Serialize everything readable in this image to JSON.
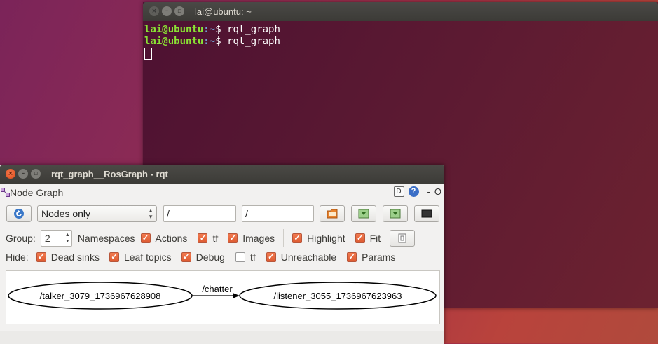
{
  "terminal": {
    "title": "lai@ubuntu: ~",
    "lines": [
      {
        "user": "lai@ubuntu",
        "path": ":~",
        "cmd": "$ rqt_graph"
      },
      {
        "user": "lai@ubuntu",
        "path": ":~",
        "cmd": "$ rqt_graph"
      }
    ]
  },
  "rqt": {
    "title": "rqt_graph__RosGraph - rqt",
    "plugin_title": "Node Graph",
    "plugin_btn_d": "D",
    "plugin_btn_help": "?",
    "plugin_btn_min": "-",
    "plugin_btn_close": "O",
    "toolbar": {
      "graph_mode": "Nodes only",
      "ns_filter": "/",
      "topic_filter": "/"
    },
    "group_row": {
      "group_label": "Group:",
      "group_value": "2",
      "namespaces_label": "Namespaces",
      "actions_label": "Actions",
      "tf_label": "tf",
      "images_label": "Images",
      "highlight_label": "Highlight",
      "fit_label": "Fit"
    },
    "hide_row": {
      "hide_label": "Hide:",
      "dead_sinks_label": "Dead sinks",
      "leaf_topics_label": "Leaf topics",
      "debug_label": "Debug",
      "tf_label": "tf",
      "unreachable_label": "Unreachable",
      "params_label": "Params"
    },
    "checks": {
      "actions": true,
      "tf": true,
      "images": true,
      "highlight": true,
      "fit": true,
      "dead_sinks": true,
      "leaf_topics": true,
      "debug": true,
      "hide_tf": false,
      "unreachable": true,
      "params": true
    },
    "graph": {
      "talker": "/talker_3079_1736967628908",
      "listener": "/listener_3055_1736967623963",
      "topic": "/chatter"
    }
  },
  "colors": {
    "accent_orange": "#e0592f",
    "prompt_green": "#8ae234",
    "prompt_blue": "#729fcf"
  }
}
